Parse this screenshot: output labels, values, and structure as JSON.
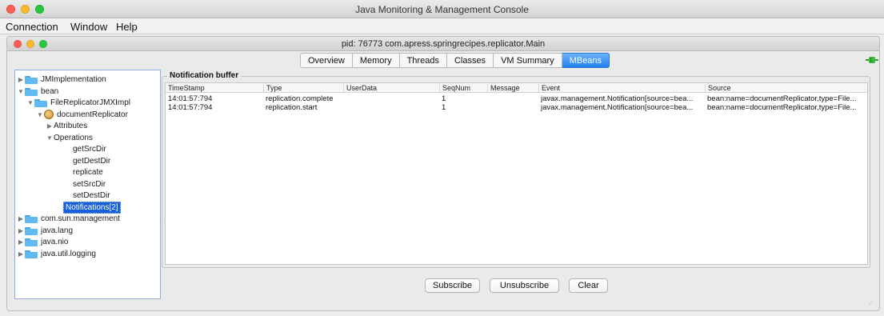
{
  "window": {
    "title": "Java Monitoring & Management Console"
  },
  "menubar": {
    "items": [
      "Connection",
      "Window",
      "Help"
    ]
  },
  "inner": {
    "title": "pid: 76773 com.apress.springrecipes.replicator.Main"
  },
  "tabs": [
    "Overview",
    "Memory",
    "Threads",
    "Classes",
    "VM Summary",
    "MBeans"
  ],
  "active_tab": "MBeans",
  "tree": {
    "nodes": [
      {
        "label": "JMImplementation",
        "kind": "folder",
        "arrow": "▶"
      },
      {
        "label": "bean",
        "kind": "folder",
        "arrow": "▼"
      },
      {
        "label": "FileReplicatorJMXImpl",
        "kind": "folder",
        "arrow": "▼"
      },
      {
        "label": "documentReplicator",
        "kind": "bean",
        "arrow": "▼"
      },
      {
        "label": "Attributes",
        "kind": "text",
        "arrow": "▶"
      },
      {
        "label": "Operations",
        "kind": "text",
        "arrow": "▼"
      },
      {
        "label": "getSrcDir",
        "kind": "text",
        "arrow": ""
      },
      {
        "label": "getDestDir",
        "kind": "text",
        "arrow": ""
      },
      {
        "label": "replicate",
        "kind": "text",
        "arrow": ""
      },
      {
        "label": "setSrcDir",
        "kind": "text",
        "arrow": ""
      },
      {
        "label": "setDestDir",
        "kind": "text",
        "arrow": ""
      },
      {
        "label": "Notifications[2]",
        "kind": "text",
        "arrow": "",
        "selected": true
      },
      {
        "label": "com.sun.management",
        "kind": "folder",
        "arrow": "▶"
      },
      {
        "label": "java.lang",
        "kind": "folder",
        "arrow": "▶"
      },
      {
        "label": "java.nio",
        "kind": "folder",
        "arrow": "▶"
      },
      {
        "label": "java.util.logging",
        "kind": "folder",
        "arrow": "▶"
      }
    ]
  },
  "buffer": {
    "title": "Notification buffer",
    "columns": [
      "TimeStamp",
      "Type",
      "UserData",
      "SeqNum",
      "Message",
      "Event",
      "Source"
    ],
    "rows": [
      [
        "14:01:57:794",
        "replication.complete",
        "",
        "1",
        "",
        "javax.management.Notification[source=bea...",
        "bean:name=documentReplicator,type=File..."
      ],
      [
        "14:01:57:794",
        "replication.start",
        "",
        "1",
        "",
        "javax.management.Notification[source=bea...",
        "bean:name=documentReplicator,type=File..."
      ]
    ]
  },
  "buttons": {
    "subscribe": "Subscribe",
    "unsubscribe": "Unsubscribe",
    "clear": "Clear"
  },
  "colors": {
    "selection": "#1760d8",
    "active_tab": "#1f7ff0",
    "folder": "#5ebaf0",
    "connected": "#2fa52f"
  },
  "icons": {
    "connection": "green-plug-icon",
    "folder": "folder-icon",
    "bean": "bean-icon"
  }
}
